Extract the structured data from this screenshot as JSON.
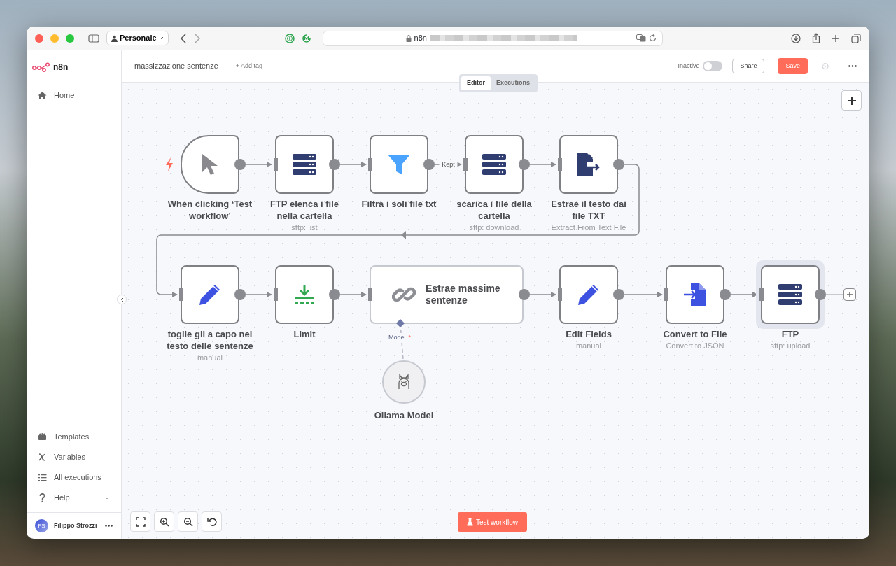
{
  "browser": {
    "profile": "Personale",
    "url": "n8n"
  },
  "app": {
    "logo": "n8n",
    "sidebar": {
      "top_items": [
        {
          "label": "Home"
        }
      ],
      "bottom_items": [
        {
          "label": "Templates"
        },
        {
          "label": "Variables"
        },
        {
          "label": "All executions"
        },
        {
          "label": "Help",
          "expandable": true
        }
      ],
      "user": {
        "initials": "FS",
        "name": "Filippo Strozzi"
      }
    },
    "header": {
      "workflow_name": "massizzazione sentenze",
      "add_tag": "+ Add tag",
      "status_label": "Inactive",
      "active": false,
      "share": "Share",
      "save": "Save"
    },
    "tabs": [
      {
        "label": "Editor",
        "selected": true
      },
      {
        "label": "Executions",
        "selected": false
      }
    ],
    "nodes": [
      {
        "kind": "trigger",
        "title": "When clicking ‘Test workflow’",
        "selected": false
      },
      {
        "kind": "action",
        "title": "FTP elenca i file nella cartella",
        "subtitle": "sftp: list",
        "selected": false
      },
      {
        "kind": "action",
        "title": "Filtra i soli file txt",
        "output_label": "Kept",
        "selected": false
      },
      {
        "kind": "action",
        "title": "scarica i file della cartella",
        "subtitle": "sftp: download",
        "selected": false
      },
      {
        "kind": "action",
        "title": "Estrae il testo dai file TXT",
        "subtitle": "Extract From Text File",
        "selected": false
      },
      {
        "kind": "action",
        "title": "toglie gli a capo nel testo delle sentenze",
        "subtitle": "manual",
        "selected": false
      },
      {
        "kind": "action",
        "title": "Limit",
        "selected": false
      },
      {
        "kind": "chain",
        "title": "Estrae massime sentenze",
        "selected": false,
        "sub_node": {
          "title": "Ollama Model",
          "connection_label": "Model",
          "required_mark": "*"
        }
      },
      {
        "kind": "action",
        "title": "Edit Fields",
        "subtitle": "manual",
        "selected": false
      },
      {
        "kind": "action",
        "title": "Convert to File",
        "subtitle": "Convert to JSON",
        "selected": false
      },
      {
        "kind": "action",
        "title": "FTP",
        "subtitle": "sftp: upload",
        "selected": true
      }
    ],
    "test_button": "Test workflow"
  }
}
